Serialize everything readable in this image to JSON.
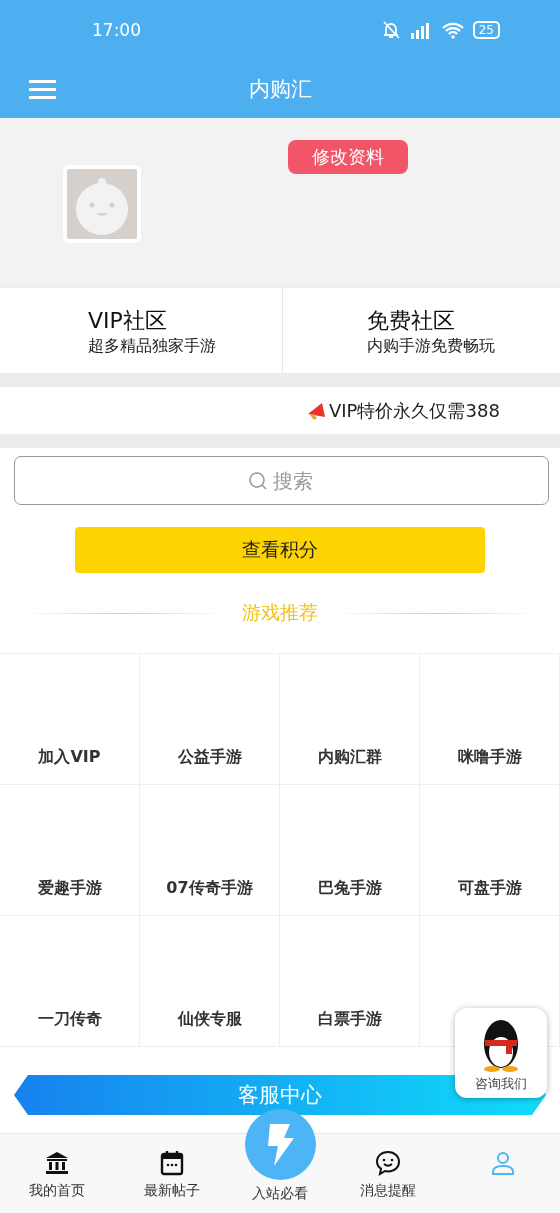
{
  "status_bar": {
    "time": "17:00",
    "battery": "25"
  },
  "header": {
    "title": "内购汇"
  },
  "profile": {
    "edit_button": "修改资料"
  },
  "communities": [
    {
      "title": "VIP社区",
      "subtitle": "超多精品独家手游"
    },
    {
      "title": "免费社区",
      "subtitle": "内购手游免费畅玩"
    }
  ],
  "notice": {
    "text": "VIP特价永久仅需388"
  },
  "search": {
    "placeholder": "搜索"
  },
  "points_button": "查看积分",
  "section_title": "游戏推荐",
  "games": [
    {
      "label": "加入VIP"
    },
    {
      "label": "公益手游"
    },
    {
      "label": "内购汇群"
    },
    {
      "label": "咪噜手游"
    },
    {
      "label": "爱趣手游"
    },
    {
      "label": "07传奇手游"
    },
    {
      "label": "巴兔手游"
    },
    {
      "label": "可盘手游"
    },
    {
      "label": "一刀传奇"
    },
    {
      "label": "仙侠专服"
    },
    {
      "label": "白票手游"
    }
  ],
  "service_banner": "客服中心",
  "consult": {
    "label": "咨询我们"
  },
  "bottom_nav": [
    {
      "kind": "home",
      "label": "我的首页",
      "selected": false
    },
    {
      "kind": "calendar",
      "label": "最新帖子",
      "selected": false
    },
    {
      "kind": "center",
      "label": "入站必看",
      "selected": false
    },
    {
      "kind": "chat",
      "label": "消息提醒",
      "selected": false
    },
    {
      "kind": "person",
      "selected": true
    }
  ]
}
